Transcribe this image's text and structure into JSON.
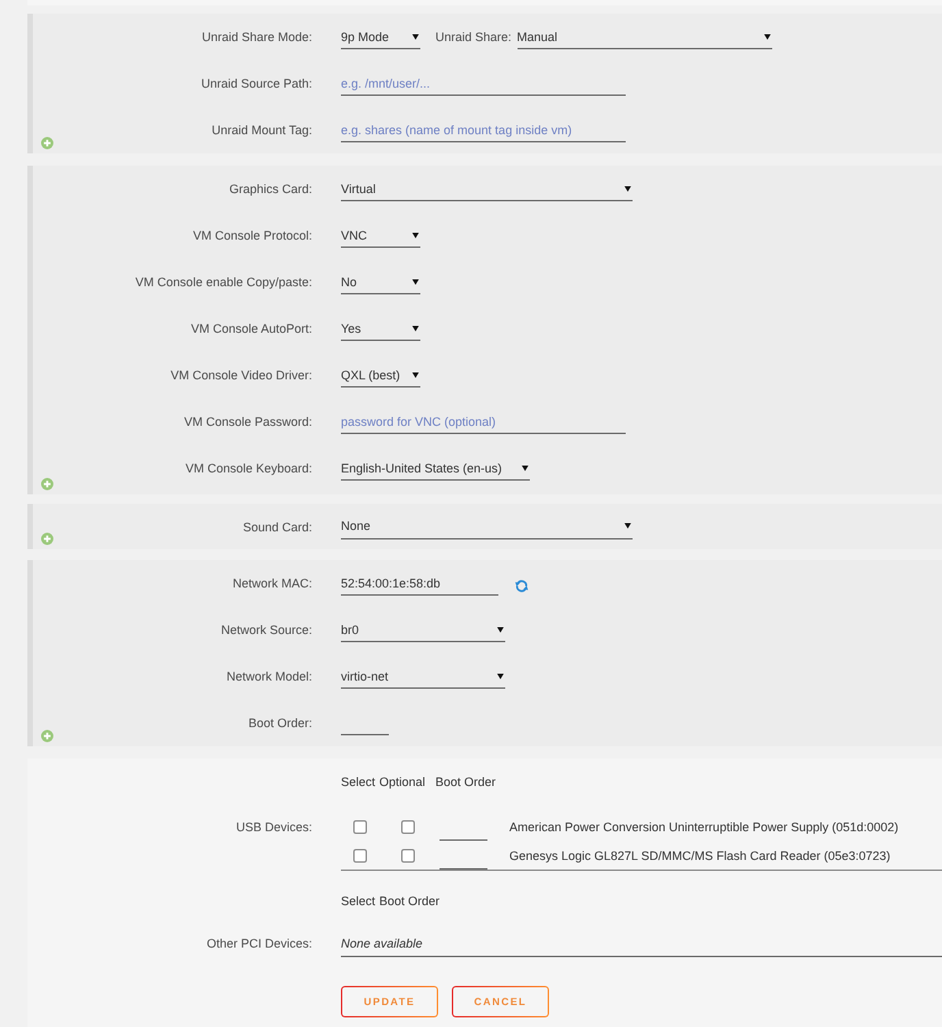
{
  "share_settings": {
    "share_mode": {
      "label": "Unraid Share Mode:",
      "value": "9p Mode"
    },
    "share": {
      "label": "Unraid Share:",
      "value": "Manual"
    },
    "source_path": {
      "label": "Unraid Source Path:",
      "placeholder": "e.g. /mnt/user/..."
    },
    "mount_tag": {
      "label": "Unraid Mount Tag:",
      "placeholder": "e.g. shares (name of mount tag inside vm)"
    }
  },
  "graphics_settings": {
    "graphics_card": {
      "label": "Graphics Card:",
      "value": "Virtual"
    },
    "console_protocol": {
      "label": "VM Console Protocol:",
      "value": "VNC"
    },
    "copy_paste": {
      "label": "VM Console enable Copy/paste:",
      "value": "No"
    },
    "autoport": {
      "label": "VM Console AutoPort:",
      "value": "Yes"
    },
    "video_driver": {
      "label": "VM Console Video Driver:",
      "value": "QXL (best)"
    },
    "console_password": {
      "label": "VM Console Password:",
      "placeholder": "password for VNC (optional)"
    },
    "console_keyboard": {
      "label": "VM Console Keyboard:",
      "value": "English-United States (en-us)"
    }
  },
  "sound_settings": {
    "sound_card": {
      "label": "Sound Card:",
      "value": "None"
    }
  },
  "network_settings": {
    "network_mac": {
      "label": "Network MAC:",
      "value": "52:54:00:1e:58:db"
    },
    "network_source": {
      "label": "Network Source:",
      "value": "br0"
    },
    "network_model": {
      "label": "Network Model:",
      "value": "virtio-net"
    },
    "boot_order": {
      "label": "Boot Order:"
    }
  },
  "usb_devices": {
    "label": "USB Devices:",
    "columns": [
      "Select",
      "Optional",
      "Boot Order"
    ],
    "devices": [
      {
        "name": "American Power Conversion Uninterruptible Power Supply (051d:0002)",
        "checked": false,
        "optional_checked": false
      },
      {
        "name": "Genesys Logic GL827L SD/MMC/MS Flash Card Reader (05e3:0723)",
        "checked": false,
        "optional_checked": false
      }
    ]
  },
  "pci_devices": {
    "label": "Other PCI Devices:",
    "columns": [
      "Select",
      "Boot Order"
    ],
    "message": "None available"
  },
  "buttons": [
    {
      "label": "UPDATE"
    },
    {
      "label": "CANCEL"
    }
  ]
}
